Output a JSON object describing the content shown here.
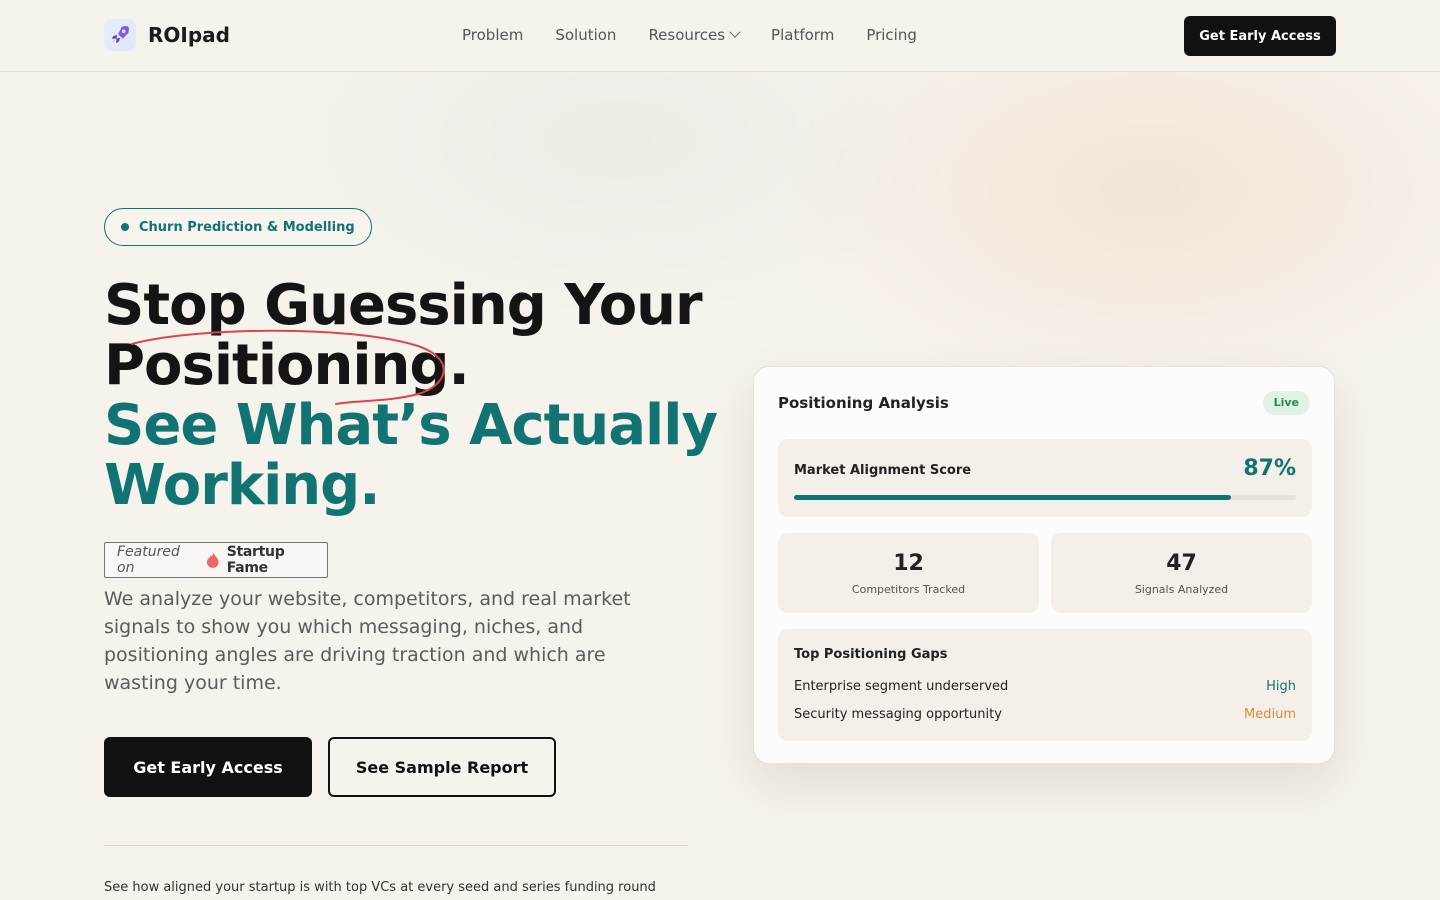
{
  "brand": {
    "name": "ROIpad",
    "logo_icon": "rocket-icon"
  },
  "nav": {
    "items": [
      {
        "label": "Problem"
      },
      {
        "label": "Solution"
      },
      {
        "label": "Resources",
        "has_dropdown": true
      },
      {
        "label": "Platform"
      },
      {
        "label": "Pricing"
      }
    ],
    "cta_label": "Get Early Access"
  },
  "hero": {
    "pill_label": "Churn Prediction & Modelling",
    "headline_line1": "Stop Guessing Your",
    "headline_line2": "Positioning.",
    "headline_line3": "See What’s Actually",
    "headline_line4": "Working.",
    "featured_prefix": "Featured on",
    "featured_brand": "Startup Fame",
    "description": "We analyze your website, competitors, and real market signals to show you which messaging, niches, and positioning angles are driving traction and which are wasting your time.",
    "primary_cta": "Get Early Access",
    "secondary_cta": "See Sample Report",
    "footnote": "See how aligned your startup is with top VCs at every seed and series funding round"
  },
  "card": {
    "title": "Positioning Analysis",
    "badge": "Live",
    "score_label": "Market Alignment Score",
    "score_value": "87%",
    "score_fraction": 0.87,
    "stats": [
      {
        "value": "12",
        "label": "Competitors Tracked"
      },
      {
        "value": "47",
        "label": "Signals Analyzed"
      }
    ],
    "gaps_title": "Top Positioning Gaps",
    "gaps": [
      {
        "label": "Enterprise segment underserved",
        "level": "High"
      },
      {
        "label": "Security messaging opportunity",
        "level": "Medium"
      }
    ]
  },
  "colors": {
    "accent": "#127373",
    "dark": "#111111",
    "medium": "#d88a3c",
    "live_bg": "#dff2e5"
  }
}
